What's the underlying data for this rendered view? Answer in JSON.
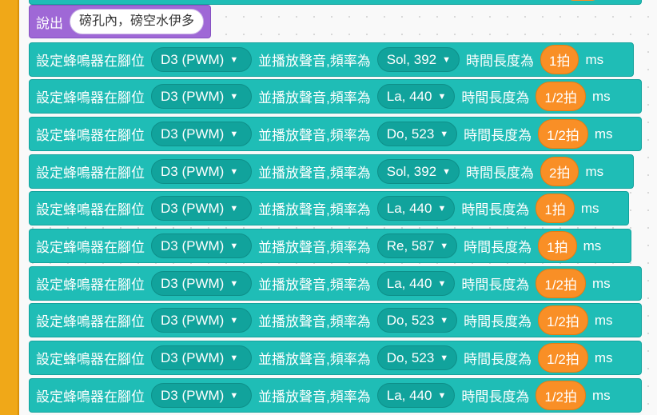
{
  "say_block": {
    "label": "說出",
    "text": "磅孔內，磅空水伊多"
  },
  "rows": [
    {
      "prefix": "設定蜂鳴器在腳位",
      "pin": "D3 (PWM)",
      "middle": "並播放聲音,頻率為",
      "freq": "Sol, 392",
      "dur_label": "時間長度為",
      "dur": "1拍",
      "unit": "ms"
    },
    {
      "prefix": "設定蜂鳴器在腳位",
      "pin": "D3 (PWM)",
      "middle": "並播放聲音,頻率為",
      "freq": "La, 440",
      "dur_label": "時間長度為",
      "dur": "1/2拍",
      "unit": "ms"
    },
    {
      "prefix": "設定蜂鳴器在腳位",
      "pin": "D3 (PWM)",
      "middle": "並播放聲音,頻率為",
      "freq": "Do, 523",
      "dur_label": "時間長度為",
      "dur": "1/2拍",
      "unit": "ms"
    },
    {
      "prefix": "設定蜂鳴器在腳位",
      "pin": "D3 (PWM)",
      "middle": "並播放聲音,頻率為",
      "freq": "Sol, 392",
      "dur_label": "時間長度為",
      "dur": "2拍",
      "unit": "ms"
    },
    {
      "prefix": "設定蜂鳴器在腳位",
      "pin": "D3 (PWM)",
      "middle": "並播放聲音,頻率為",
      "freq": "La, 440",
      "dur_label": "時間長度為",
      "dur": "1拍",
      "unit": "ms"
    },
    {
      "prefix": "設定蜂鳴器在腳位",
      "pin": "D3 (PWM)",
      "middle": "並播放聲音,頻率為",
      "freq": "Re, 587",
      "dur_label": "時間長度為",
      "dur": "1拍",
      "unit": "ms"
    },
    {
      "prefix": "設定蜂鳴器在腳位",
      "pin": "D3 (PWM)",
      "middle": "並播放聲音,頻率為",
      "freq": "La, 440",
      "dur_label": "時間長度為",
      "dur": "1/2拍",
      "unit": "ms"
    },
    {
      "prefix": "設定蜂鳴器在腳位",
      "pin": "D3 (PWM)",
      "middle": "並播放聲音,頻率為",
      "freq": "Do, 523",
      "dur_label": "時間長度為",
      "dur": "1/2拍",
      "unit": "ms"
    },
    {
      "prefix": "設定蜂鳴器在腳位",
      "pin": "D3 (PWM)",
      "middle": "並播放聲音,頻率為",
      "freq": "Do, 523",
      "dur_label": "時間長度為",
      "dur": "1/2拍",
      "unit": "ms"
    },
    {
      "prefix": "設定蜂鳴器在腳位",
      "pin": "D3 (PWM)",
      "middle": "並播放聲音,頻率為",
      "freq": "La, 440",
      "dur_label": "時間長度為",
      "dur": "1/2拍",
      "unit": "ms"
    }
  ],
  "icons": {
    "dropdown": "caret-down-icon"
  },
  "colors": {
    "block": "#1fbdb6",
    "dropdown": "#11a39c",
    "duration": "#f98f26",
    "say": "#9f68d6",
    "hat": "#f0a818"
  }
}
